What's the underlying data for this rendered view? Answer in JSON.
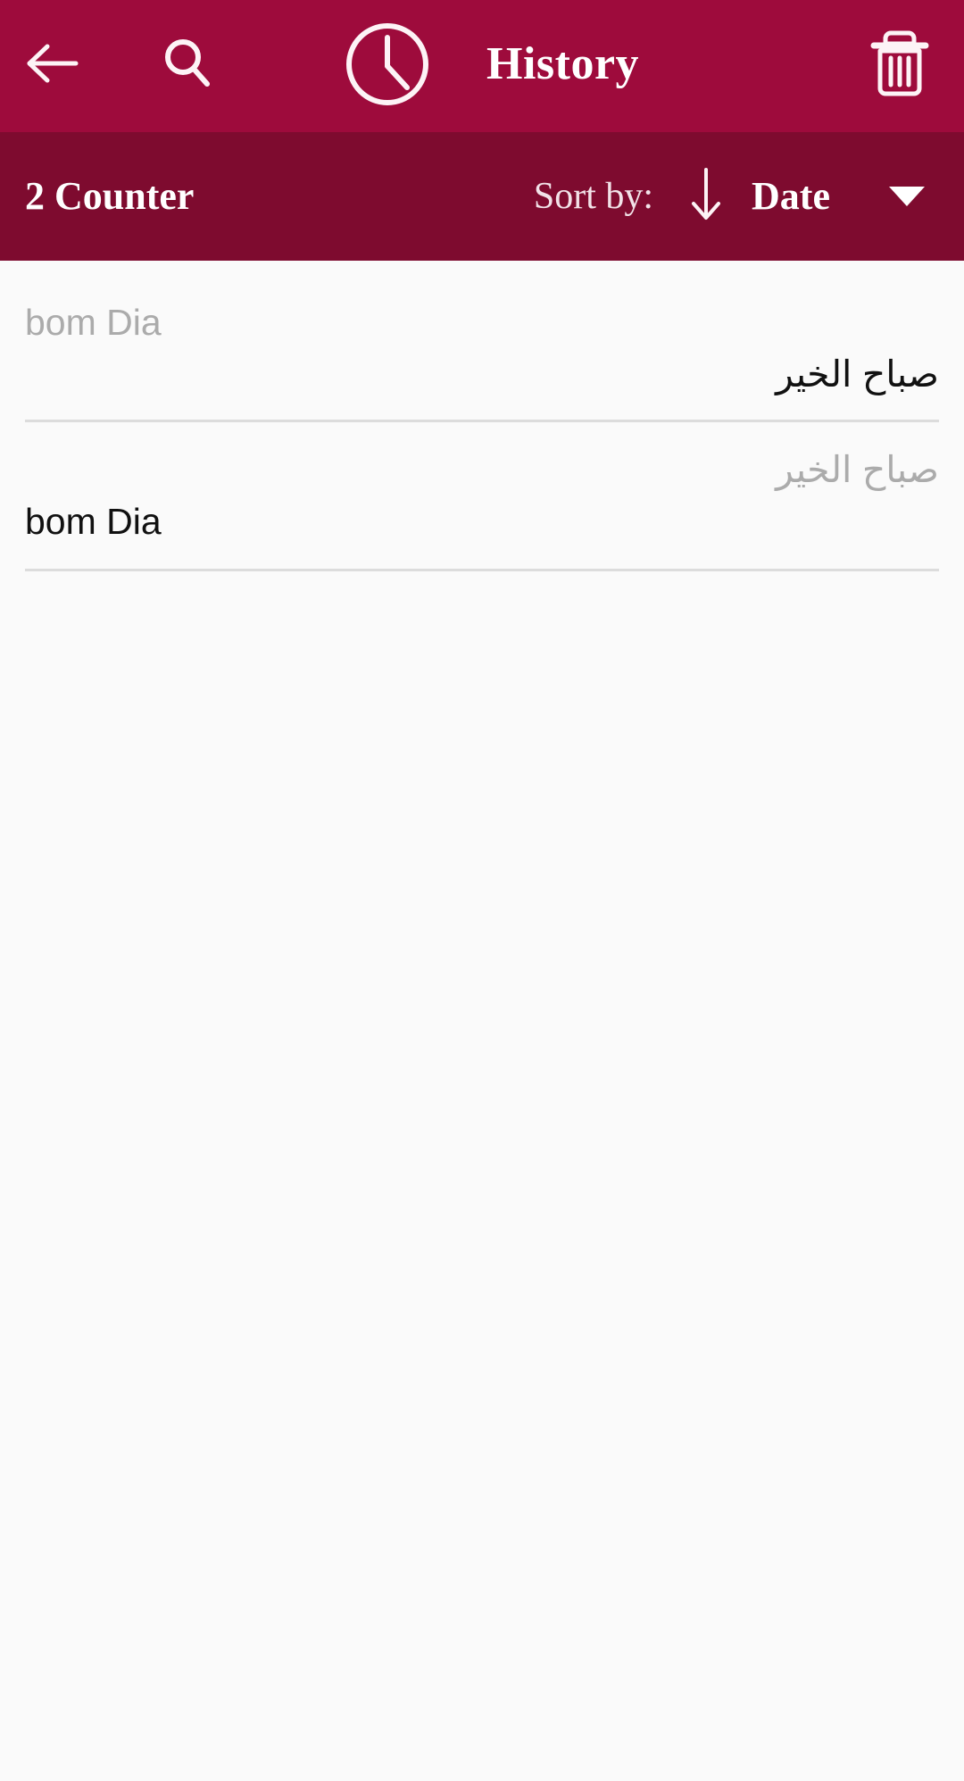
{
  "appbar": {
    "back_icon": "arrow-left-icon",
    "search_icon": "search-icon",
    "clock_icon": "clock-icon",
    "title": "History",
    "delete_icon": "trash-icon",
    "bg_color": "#9E0B3C"
  },
  "subbar": {
    "counter_label": "2 Counter",
    "sort_label": "Sort by:",
    "sort_direction_icon": "arrow-down-icon",
    "sort_value": "Date",
    "dropdown_icon": "caret-down-icon",
    "bg_color": "#7E0B2F"
  },
  "history": {
    "items": [
      {
        "source_text": "bom Dia",
        "source_align": "ltr",
        "translated_text": "صباح الخير",
        "translated_align": "rtl"
      },
      {
        "source_text": "صباح الخير",
        "source_align": "rtl",
        "translated_text": "bom Dia",
        "translated_align": "ltr"
      }
    ]
  },
  "colors": {
    "primary": "#9E0B3C",
    "primary_dark": "#7E0B2F",
    "background": "#FAFAFA",
    "source_text": "#ABABAB",
    "translated_text": "#111111",
    "divider": "#DCDCDC"
  }
}
